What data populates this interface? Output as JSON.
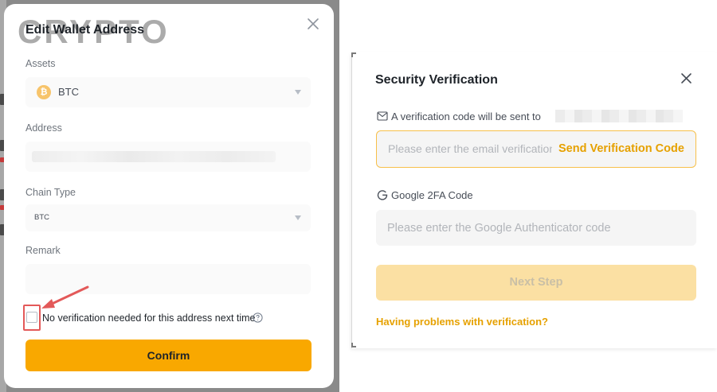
{
  "watermark": "CRYPTO",
  "edit_wallet": {
    "title": "Edit Wallet Address",
    "assets_label": "Assets",
    "asset_value": "BTC",
    "asset_coin_glyph": "₿",
    "address_label": "Address",
    "chain_type_label": "Chain Type",
    "chain_type_value": "BTC",
    "remark_label": "Remark",
    "no_verification_label": "No verification needed for this address next time",
    "confirm_label": "Confirm"
  },
  "security_verification": {
    "title": "Security Verification",
    "code_sent_text": "A verification code will be sent to",
    "email_code_placeholder": "Please enter the email verification code",
    "send_code_label": "Send Verification Code",
    "google_label": "Google 2FA Code",
    "google_placeholder": "Please enter the Google Authenticator code",
    "next_step_label": "Next Step",
    "problems_link": "Having problems with verification?"
  },
  "colors": {
    "accent_yellow": "#f9a800",
    "link_yellow": "#e6a100",
    "disabled_button": "#fbe0a3",
    "annotation_red": "#e35959"
  },
  "icons": [
    "close-icon",
    "bitcoin-coin-icon",
    "chevron-down-icon",
    "help-circle-icon",
    "mail-icon",
    "google-icon",
    "annotation-arrow"
  ]
}
